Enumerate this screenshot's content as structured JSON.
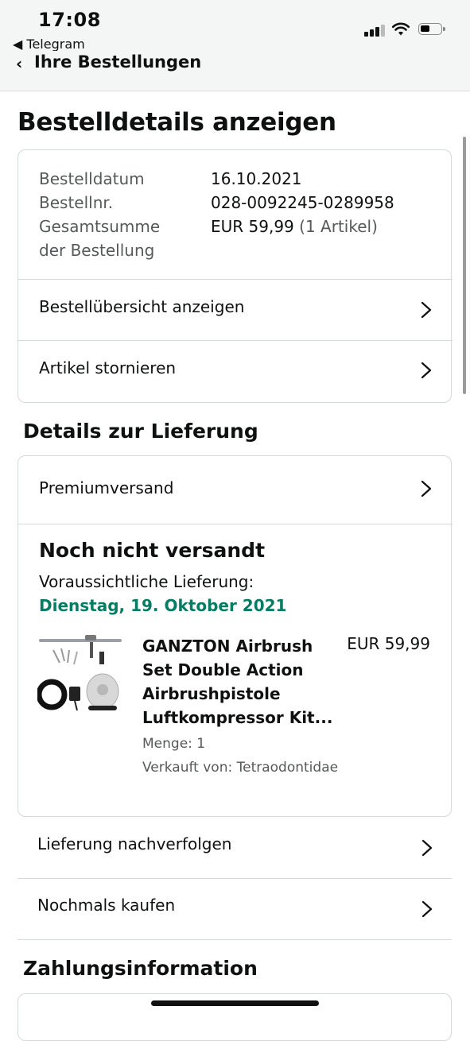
{
  "status_bar": {
    "time": "17:08",
    "back_app": "Telegram"
  },
  "nav": {
    "title": "Ihre Bestellungen"
  },
  "page": {
    "title": "Bestelldetails anzeigen"
  },
  "order": {
    "date_label": "Bestelldatum",
    "date_value": "16.10.2021",
    "number_label": "Bestellnr.",
    "number_value": "028-0092245-0289958",
    "total_label_1": "Gesamtsumme",
    "total_label_2": "der Bestellung",
    "total_value": "EUR 59,99",
    "total_count": "(1 Artikel)",
    "overview_link": "Bestellübersicht anzeigen",
    "cancel_link": "Artikel stornieren"
  },
  "delivery": {
    "heading": "Details zur Lieferung",
    "shipping_method": "Premiumversand",
    "status": "Noch nicht versandt",
    "expected_label": "Voraussichtliche Lieferung:",
    "expected_date": "Dienstag, 19. Oktober 2021",
    "expected_date_color": "#067d62",
    "product": {
      "title_line1": "GANZTON Airbrush",
      "title_line2": "Set Double Action",
      "title_line3": "Airbrushpistole",
      "title_line4": "Luftkompressor Kit...",
      "price": "EUR 59,99",
      "quantity": "Menge: 1",
      "seller": "Verkauft von: Tetraodontidae"
    },
    "track_link": "Lieferung nachverfolgen",
    "buy_again_link": "Nochmals kaufen"
  },
  "payment": {
    "heading": "Zahlungsinformation"
  }
}
